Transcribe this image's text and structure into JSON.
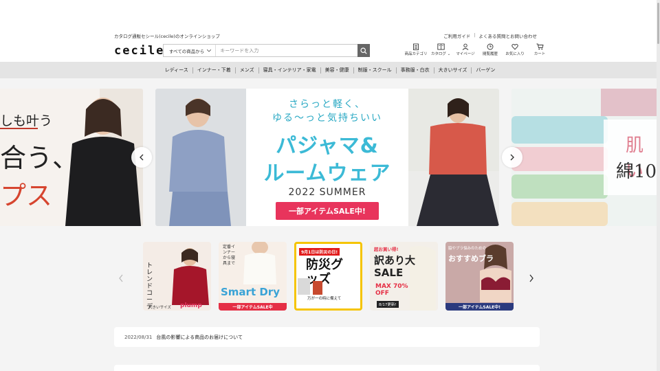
{
  "header": {
    "tagline": "カタログ通販セシール(cecile)のオンラインショップ",
    "links": [
      "ご利用ガイド",
      "よくある質問とお問い合わせ"
    ],
    "logo": "cecile",
    "search": {
      "scope": "すべての商品から",
      "placeholder": "キーワードを入力"
    },
    "icons": [
      {
        "label": "商品カテゴリ",
        "icon": "category-icon"
      },
      {
        "label": "カタログ",
        "icon": "catalog-icon"
      },
      {
        "label": "マイページ",
        "icon": "user-icon"
      },
      {
        "label": "閲覧履歴",
        "icon": "clock-icon"
      },
      {
        "label": "お気に入り",
        "icon": "heart-icon"
      },
      {
        "label": "カート",
        "icon": "cart-icon"
      }
    ]
  },
  "nav": [
    "レディース",
    "インナー・下着",
    "メンズ",
    "寝具・インテリア・家電",
    "美容・健康",
    "制服・スクール",
    "事務服・白衣",
    "大きいサイズ",
    "バーゲン"
  ],
  "hero": {
    "left_lines": [
      "しも叶う",
      "合う、",
      "プス"
    ],
    "main": {
      "copy1": "さらっと軽く、",
      "copy2": "ゆる〜っと気持ちいい",
      "title1": "パジャマ&",
      "title2": "ルームウェア",
      "season": "2022 SUMMER",
      "sale": "一部アイテムSALE中!"
    },
    "right_lines": [
      "肌い",
      "綿10"
    ]
  },
  "subbanners": [
    {
      "text": "トレンドコーデ",
      "small": "大きいサイズ",
      "brand": "plump",
      "bg": "#f4ece6",
      "accent": "#a5162a"
    },
    {
      "text": "Smart Dry",
      "small": "定番インナーから寝具まで",
      "strip": "一部アイテムSALE中",
      "bg": "#f7efe8",
      "accent": "#3aa3d6"
    },
    {
      "text": "防災グッズ",
      "small": "9月1日は防災の日!",
      "sub": "万が一の時に備えて",
      "bg": "#ffffff",
      "accent": "#e11a1a"
    },
    {
      "text": "訳あり大SALE",
      "small": "超お買い得!",
      "percent": "MAX 70% OFF",
      "date": "8/17更新!",
      "bg": "#f3efe9",
      "accent": "#e52f45"
    },
    {
      "text": "おすすめブラ",
      "small": "脇やブラ悩みのための",
      "strip": "一部アイテムSALE中!",
      "bg": "#c9a9a7",
      "accent": "#2b3a7e"
    }
  ],
  "news": {
    "date": "2022/08/31",
    "text": "台風の影響による商品のお届けについて"
  },
  "colors": {
    "nav_bg": "#e4e4e4",
    "accent_blue": "#3cbad6",
    "sale_pink": "#e8345c",
    "search_btn": "#666666"
  }
}
